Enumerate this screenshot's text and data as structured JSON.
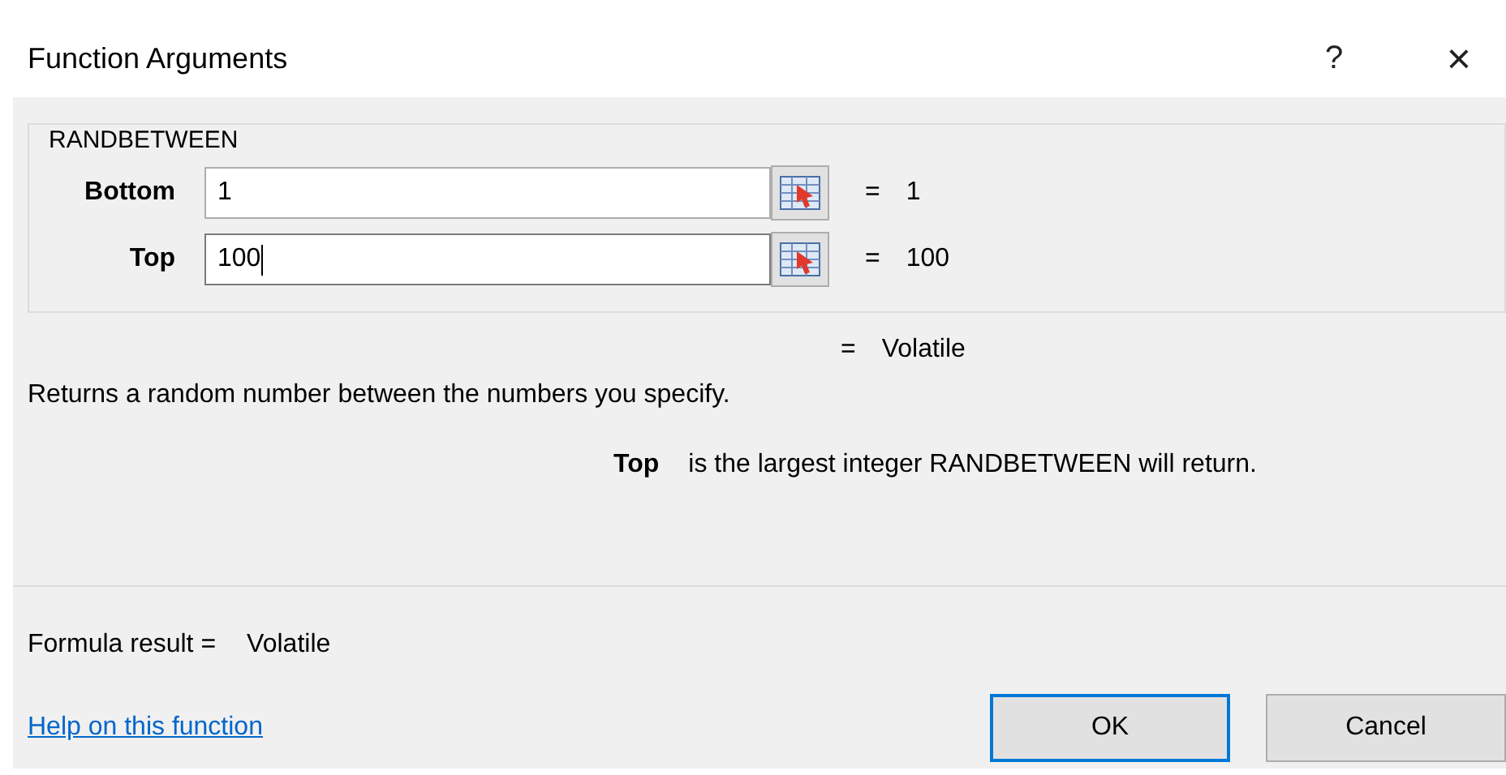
{
  "window": {
    "title": "Function Arguments",
    "help": "?",
    "close": "×"
  },
  "function_name": "RANDBETWEEN",
  "arguments": [
    {
      "label": "Bottom",
      "value": "1",
      "equals": "=",
      "result": "1",
      "focused": false
    },
    {
      "label": "Top",
      "value": "100",
      "equals": "=",
      "result": "100",
      "focused": true
    }
  ],
  "function_result": {
    "equals": "=",
    "value": "Volatile"
  },
  "description": "Returns a random number between the numbers you specify.",
  "argument_help": {
    "name": "Top",
    "text": "is the largest integer RANDBETWEEN will return."
  },
  "formula_result": {
    "label": "Formula result =",
    "value": "Volatile"
  },
  "help_link": "Help on this function",
  "buttons": [
    {
      "label": "OK",
      "default": true
    },
    {
      "label": "Cancel",
      "default": false
    }
  ]
}
